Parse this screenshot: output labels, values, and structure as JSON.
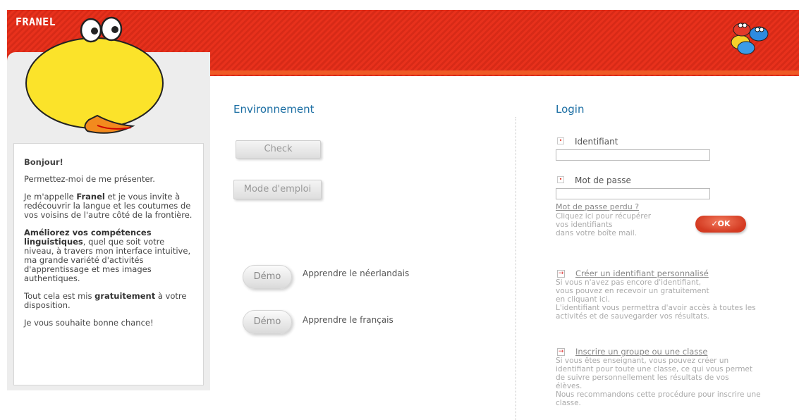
{
  "brand": {
    "name": "FRANEL"
  },
  "colors": {
    "banner": "#e8311c",
    "title": "#1b6ea3",
    "ok": "#d43b22"
  },
  "intro": {
    "hello": "Bonjour!",
    "p1": "Permettez-moi de me présenter.",
    "p2_a": "Je m'appelle ",
    "p2_b": "Franel",
    "p2_c": " et je vous invite à redécouvrir la langue et les coutumes de vos voisins de l'autre côté de la frontière.",
    "p3_a": "Améliorez vos compétences linguistiques",
    "p3_b": ", quel que soit votre niveau, à travers mon interface intuitive, ma grande variété d'activités d'apprentissage et mes images authentiques.",
    "p4_a": "Tout cela est mis ",
    "p4_b": "gratuitement",
    "p4_c": " à votre disposition.",
    "p5": "Je vous souhaite bonne chance!"
  },
  "environment": {
    "title": "Environnement",
    "check_label": "Check",
    "manual_label": "Mode d'emploi",
    "demos": [
      {
        "button": "Démo",
        "label": "Apprendre le néerlandais"
      },
      {
        "button": "Démo",
        "label": "Apprendre le français"
      }
    ]
  },
  "login": {
    "title": "Login",
    "identifier_label": "Identifiant",
    "password_label": "Mot de passe",
    "forgot_link": "Mot de passe perdu ?",
    "forgot_help": [
      "Cliquez ici pour récupérer",
      "vos identifiants",
      "dans votre boîte mail."
    ],
    "ok_label": "OK",
    "create_link": "Créer un identifiant personnalisé",
    "create_help": [
      "Si vous n'avez pas encore d'identifiant,",
      "vous pouvez en recevoir un gratuitement",
      "en cliquant ici.",
      "L'identifiant vous permettra d'avoir accès à toutes les",
      "activités et de sauvegarder vos résultats."
    ],
    "group_link": "Inscrire un groupe ou une classe",
    "group_help": [
      "Si vous êtes enseignant, vous pouvez créer un",
      "identifiant pour toute une classe, ce qui vous permet",
      "de suivre personnellement les résultats de vos",
      "élèves.",
      "Nous recommandons cette procédure pour inscrire une",
      "classe."
    ]
  }
}
